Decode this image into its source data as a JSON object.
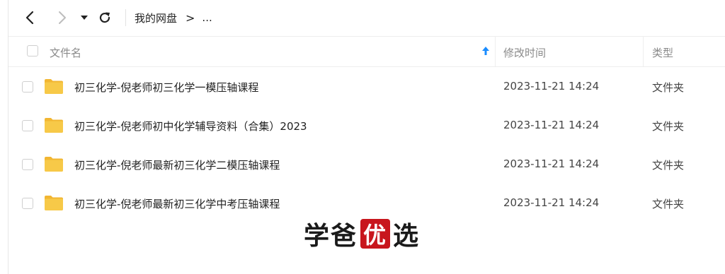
{
  "toolbar": {
    "back_icon": "chevron-left-icon",
    "forward_icon": "chevron-right-icon",
    "dropdown_icon": "caret-down-icon",
    "refresh_icon": "refresh-icon",
    "breadcrumb": {
      "root": "我的网盘",
      "separator": ">",
      "more": "..."
    }
  },
  "header": {
    "name": "文件名",
    "modified": "修改时间",
    "type": "类型",
    "sort_icon": "arrow-up-icon"
  },
  "files": [
    {
      "name": "初三化学-倪老师初三化学一模压轴课程",
      "modified": "2023-11-21 14:24",
      "type": "文件夹"
    },
    {
      "name": "初三化学-倪老师初中化学辅导资料（合集）2023",
      "modified": "2023-11-21 14:24",
      "type": "文件夹"
    },
    {
      "name": "初三化学-倪老师最新初三化学二模压轴课程",
      "modified": "2023-11-21 14:24",
      "type": "文件夹"
    },
    {
      "name": "初三化学-倪老师最新初三化学中考压轴课程",
      "modified": "2023-11-21 14:24",
      "type": "文件夹"
    }
  ],
  "watermark": {
    "part1": "学爸",
    "stamp": "优",
    "part2": "选"
  },
  "colors": {
    "folder": "#f7c948",
    "folder_back": "#f2b632",
    "sort_arrow": "#1a8cff",
    "stamp": "#c8161d"
  }
}
